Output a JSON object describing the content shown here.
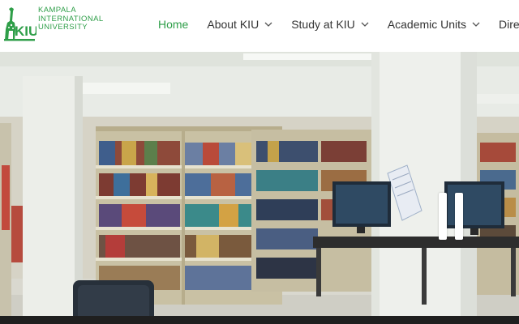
{
  "logo": {
    "mark_letters": "KIU",
    "line1": "KAMPALA",
    "line2": "INTERNATIONAL",
    "line3": "UNIVERSITY"
  },
  "nav": {
    "items": [
      {
        "label": "Home",
        "active": true
      },
      {
        "label": "About KIU",
        "dropdown": true
      },
      {
        "label": "Study at KIU",
        "dropdown": true
      },
      {
        "label": "Academic Units",
        "dropdown": true
      },
      {
        "label": "Direct",
        "dropdown": false
      }
    ]
  },
  "hero": {
    "image": "library-bookshelves-computers",
    "control_icon": "pause-icon"
  },
  "colors": {
    "brand_green": "#2e9e48",
    "nav_text": "#333333",
    "bottom_bar": "#1f1f1f"
  }
}
